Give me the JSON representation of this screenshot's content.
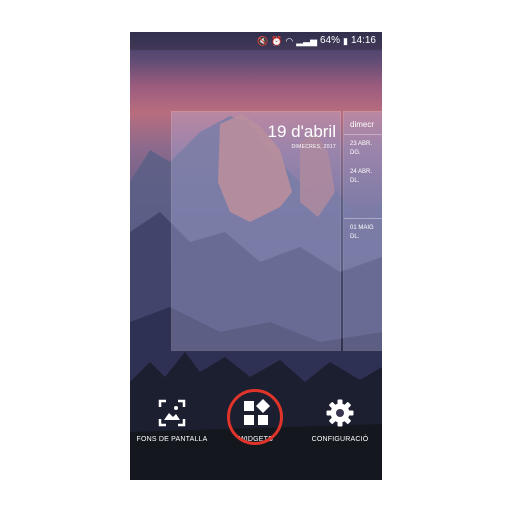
{
  "status_bar": {
    "battery": "64%",
    "time": "14:16"
  },
  "date_widget": {
    "date": "19 d'abril",
    "weekday_year": "DIMECRES, 2017"
  },
  "calendar_widget": {
    "header": "dimecr",
    "events": [
      {
        "date": "23 ABR.",
        "day": "DG."
      },
      {
        "date": "24 ABR.",
        "day": "DL."
      },
      {
        "date": "01 MAIG",
        "day": "DL."
      }
    ]
  },
  "bottom_menu": {
    "items": [
      {
        "label": "FONS DE PANTALLA",
        "icon": "wallpaper-icon"
      },
      {
        "label": "WIDGETS",
        "icon": "widgets-icon"
      },
      {
        "label": "CONFIGURACIÓ",
        "icon": "settings-gear-icon"
      }
    ]
  },
  "colors": {
    "highlight_ring": "#e0342a"
  }
}
